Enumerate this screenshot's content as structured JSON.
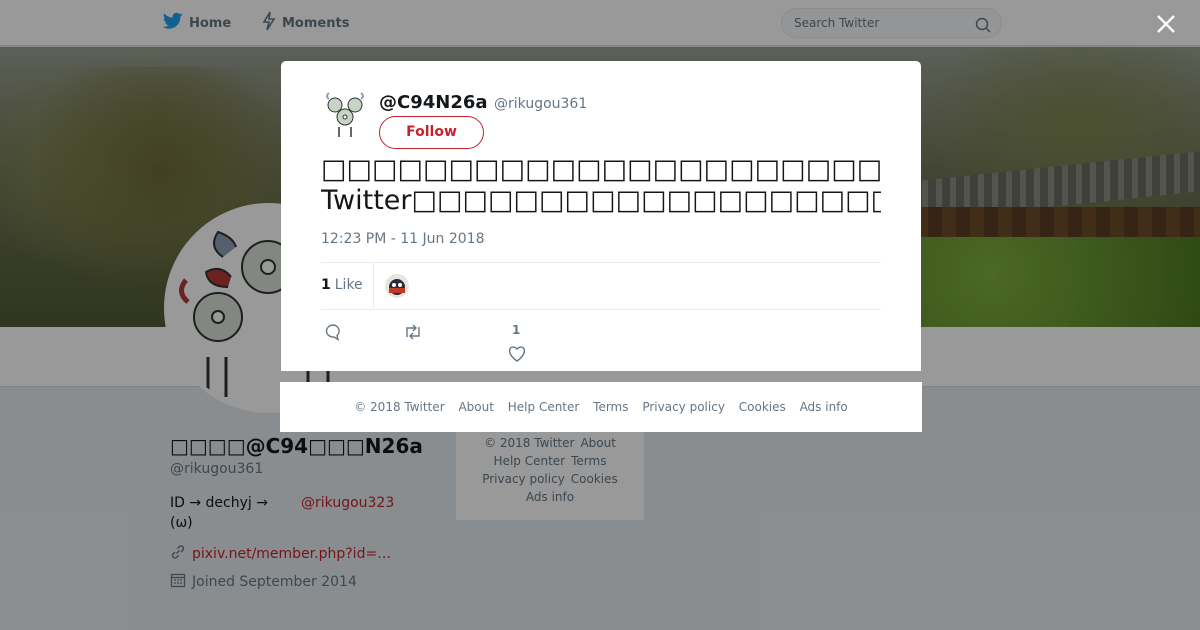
{
  "topbar": {
    "home_label": "Home",
    "moments_label": "Moments",
    "search_placeholder": "Search Twitter"
  },
  "profile": {
    "name": "□□□□@C94□□□N26a",
    "handle": "@rikugou361",
    "bio_line1": "ID → dechyj  →",
    "bio_mention": "@rikugou323",
    "bio_line2": "(ω)",
    "link": "pixiv.net/member.php?id=…",
    "joined": "Joined September 2014"
  },
  "side_footer": {
    "items": [
      "© 2018 Twitter",
      "About",
      "Help Center",
      "Terms",
      "Privacy policy",
      "Cookies",
      "Ads info"
    ]
  },
  "tweet": {
    "display_name": "@C94N26a",
    "handle": "@rikugou361",
    "follow_label": "Follow",
    "caret": "⌄",
    "text_line1": "□□□□□□□□□□□□□□□□□□□□□□□□□□□□□□□□□□□□□□…",
    "text_line2": "Twitter□□□□□□□□□□□□□□□□□□□□□□□□□□□□□□□□□□",
    "timestamp": "12:23 PM - 11 Jun 2018",
    "likes_count": "1",
    "likes_label": "Like",
    "action_like_count": "1"
  },
  "modal_footer": {
    "items": [
      "© 2018 Twitter",
      "About",
      "Help Center",
      "Terms",
      "Privacy policy",
      "Cookies",
      "Ads info"
    ]
  },
  "colors": {
    "accent": "#c4242d",
    "twitter_blue": "#1da1f2",
    "muted_text": "#657786"
  },
  "icons": {
    "logo": "twitter-bird-icon",
    "moments": "lightning-icon",
    "search": "search-icon",
    "close": "close-icon",
    "link": "link-icon",
    "calendar": "calendar-icon",
    "reply": "reply-icon",
    "retweet": "retweet-icon",
    "like": "heart-icon"
  }
}
